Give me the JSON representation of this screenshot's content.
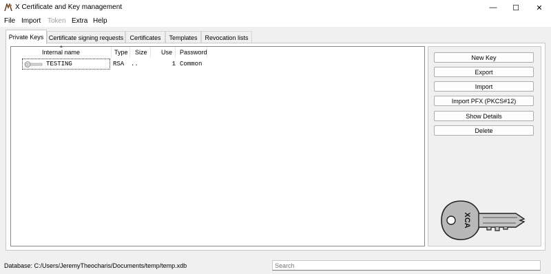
{
  "window": {
    "title": "X Certificate and Key management",
    "controls": {
      "minimize": "—",
      "maximize": "☐",
      "close": "✕"
    }
  },
  "menu": {
    "items": [
      {
        "label": "File",
        "enabled": true
      },
      {
        "label": "Import",
        "enabled": true
      },
      {
        "label": "Token",
        "enabled": false
      },
      {
        "label": "Extra",
        "enabled": true
      },
      {
        "label": "Help",
        "enabled": true
      }
    ]
  },
  "tabs": [
    {
      "label": "Private Keys",
      "active": true
    },
    {
      "label": "Certificate signing requests",
      "active": false
    },
    {
      "label": "Certificates",
      "active": false
    },
    {
      "label": "Templates",
      "active": false
    },
    {
      "label": "Revocation lists",
      "active": false
    }
  ],
  "table": {
    "columns": [
      "Internal name",
      "Type",
      "Size",
      "Use",
      "Password"
    ],
    "rows": [
      {
        "name": "TESTING",
        "type": "RSA",
        "size": "..",
        "use": "1",
        "password": "Common",
        "icon": "key-icon"
      }
    ]
  },
  "actions": {
    "new_key": "New Key",
    "export": "Export",
    "import": "Import",
    "import_pfx": "Import PFX (PKCS#12)",
    "show_details": "Show Details",
    "delete": "Delete"
  },
  "logo": {
    "text": "XCA",
    "icon": "key-logo-icon"
  },
  "status": {
    "database": "Database: C:/Users/JeremyTheocharis/Documents/temp/temp.xdb",
    "search_placeholder": "Search",
    "search_value": ""
  }
}
